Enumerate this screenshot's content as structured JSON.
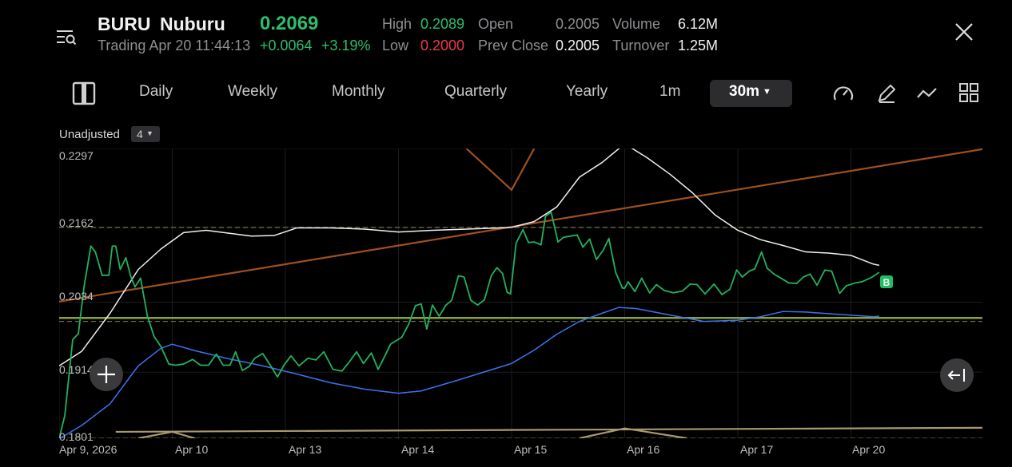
{
  "header": {
    "ticker": "BURU",
    "name": "Nuburu",
    "price": "0.2069",
    "status": "Trading Apr 20 11:44:13",
    "change": "+0.0064",
    "change_pct": "+3.19%",
    "high_label": "High",
    "high_value": "0.2089",
    "low_label": "Low",
    "low_value": "0.2000",
    "open_label": "Open",
    "open_value": "0.2005",
    "prev_close_label": "Prev Close",
    "prev_close_value": "0.2005",
    "volume_label": "Volume",
    "volume_value": "6.12M",
    "turnover_label": "Turnover",
    "turnover_value": "1.25M",
    "menu_icon": "menu-search-icon",
    "close_icon": "close-icon"
  },
  "toolbar": {
    "layout_icon": "split-layout-icon",
    "tabs": [
      "Daily",
      "Weekly",
      "Monthly",
      "Quarterly",
      "Yearly",
      "1m",
      "30m"
    ],
    "active_tab": "30m",
    "tools": [
      "speedometer-icon",
      "pen-icon",
      "line-icon",
      "grid-icon"
    ]
  },
  "chart_options": {
    "adjust_label": "Unadjusted",
    "indicator_count": "4"
  },
  "colors": {
    "price_line": "#21b25f",
    "ma_blue": "#3b73f0",
    "ma_white": "#f0f0f0",
    "trend_brown": "#a0501e",
    "support_olive": "#8aa23a",
    "bottom_tan": "#a89a6e",
    "buy_marker": "#1fbf5f"
  },
  "chart_data": {
    "type": "line",
    "ylim": [
      0.1801,
      0.2297
    ],
    "yticks": [
      "0.2297",
      "0.2162",
      "0.2034",
      "0.1914",
      "0.1801"
    ],
    "xticks": [
      "Apr 9, 2026",
      "Apr 10",
      "Apr 13",
      "Apr 14",
      "Apr 15",
      "Apr 16",
      "Apr 17",
      "Apr 20"
    ],
    "x_positions": [
      0,
      1,
      2,
      3,
      4,
      5,
      6,
      7
    ],
    "buy_marker_label": "B",
    "series": [
      {
        "key": "price",
        "color": "#21b25f",
        "x": [
          0,
          0.05,
          0.12,
          0.17,
          0.22,
          0.28,
          0.32,
          0.38,
          0.44,
          0.47,
          0.5,
          0.54,
          0.59,
          0.63,
          0.67,
          0.72,
          0.78,
          0.84,
          0.9,
          0.97,
          1.03,
          1.1,
          1.18,
          1.25,
          1.32,
          1.39,
          1.45,
          1.51,
          1.56,
          1.62,
          1.68,
          1.73,
          1.8,
          1.87,
          1.93,
          1.99,
          2.05,
          2.12,
          2.2,
          2.27,
          2.34,
          2.42,
          2.5,
          2.57,
          2.63,
          2.69,
          2.76,
          2.82,
          2.88,
          2.93,
          2.98,
          3.03,
          3.09,
          3.15,
          3.2,
          3.25,
          3.3,
          3.36,
          3.42,
          3.47,
          3.53,
          3.58,
          3.64,
          3.7,
          3.76,
          3.82,
          3.87,
          3.92,
          3.96,
          3.99,
          4.04,
          4.1,
          4.15,
          4.2,
          4.26,
          4.3,
          4.35,
          4.41,
          4.46,
          4.52,
          4.58,
          4.63,
          4.69,
          4.75,
          4.81,
          4.86,
          4.92,
          4.98,
          5.0,
          5.03,
          5.09,
          5.15,
          5.22,
          5.28,
          5.35,
          5.43,
          5.51,
          5.58,
          5.64,
          5.71,
          5.79,
          5.86,
          5.93,
          5.99,
          6.04,
          6.1,
          6.15,
          6.21,
          6.26,
          6.32,
          6.39,
          6.45,
          6.52,
          6.58,
          6.64,
          6.7,
          6.77,
          6.83,
          6.9,
          6.96,
          7.04,
          7.1,
          7.18,
          7.25
        ],
        "y": [
          0.18,
          0.184,
          0.197,
          0.198,
          0.206,
          0.213,
          0.212,
          0.208,
          0.208,
          0.213,
          0.213,
          0.209,
          0.211,
          0.208,
          0.206,
          0.2075,
          0.201,
          0.1975,
          0.1958,
          0.1928,
          0.1926,
          0.1928,
          0.1936,
          0.1926,
          0.1926,
          0.1945,
          0.1926,
          0.1926,
          0.1949,
          0.1917,
          0.1924,
          0.1938,
          0.1946,
          0.1925,
          0.1906,
          0.1927,
          0.1942,
          0.1925,
          0.1938,
          0.1935,
          0.1949,
          0.1919,
          0.1916,
          0.1933,
          0.1949,
          0.1929,
          0.1947,
          0.1919,
          0.1942,
          0.1962,
          0.1968,
          0.1974,
          0.1996,
          0.2028,
          0.2031,
          0.1988,
          0.2029,
          0.201,
          0.2029,
          0.2037,
          0.2079,
          0.2077,
          0.2037,
          0.2029,
          0.2038,
          0.2079,
          0.2093,
          0.2083,
          0.2051,
          0.2048,
          0.2135,
          0.2158,
          0.2136,
          0.2137,
          0.2132,
          0.2181,
          0.2188,
          0.2137,
          0.2145,
          0.2147,
          0.2149,
          0.2128,
          0.2142,
          0.2107,
          0.2123,
          0.2143,
          0.2085,
          0.2058,
          0.2058,
          0.2069,
          0.2052,
          0.2075,
          0.205,
          0.2064,
          0.2054,
          0.205,
          0.2053,
          0.2065,
          0.2064,
          0.2048,
          0.2065,
          0.2047,
          0.2056,
          0.2089,
          0.2077,
          0.2087,
          0.2091,
          0.212,
          0.2092,
          0.2082,
          0.2074,
          0.2067,
          0.2066,
          0.2077,
          0.2082,
          0.2063,
          0.2089,
          0.2087,
          0.2049,
          0.2062,
          0.2067,
          0.2069,
          0.2076,
          0.2085
        ]
      },
      {
        "key": "ma_blue",
        "color": "#3b73f0",
        "x": [
          0,
          0.2,
          0.45,
          0.7,
          0.9,
          1.0,
          1.2,
          1.5,
          1.8,
          2.1,
          2.4,
          2.7,
          3.0,
          3.2,
          3.5,
          3.8,
          4.0,
          4.2,
          4.4,
          4.6,
          4.8,
          4.95,
          5.1,
          5.4,
          5.7,
          6.0,
          6.2,
          6.4,
          6.6,
          6.9,
          7.2,
          7.25
        ],
        "y": [
          0.18,
          0.1823,
          0.186,
          0.1925,
          0.1955,
          0.1962,
          0.1951,
          0.1937,
          0.1925,
          0.1911,
          0.1896,
          0.1885,
          0.1878,
          0.1882,
          0.1899,
          0.1917,
          0.1929,
          0.1952,
          0.1979,
          0.2001,
          0.2015,
          0.2025,
          0.2023,
          0.2012,
          0.2001,
          0.2003,
          0.2009,
          0.2018,
          0.2017,
          0.2013,
          0.2009,
          0.201
        ]
      },
      {
        "key": "ma_white",
        "color": "#f0f0f0",
        "x": [
          0,
          0.2,
          0.45,
          0.7,
          0.9,
          1.1,
          1.3,
          1.5,
          1.7,
          1.9,
          2.1,
          2.4,
          2.7,
          3.0,
          3.3,
          3.6,
          3.9,
          4.0,
          4.2,
          4.4,
          4.6,
          4.8,
          5.0,
          5.2,
          5.4,
          5.6,
          5.8,
          6.0,
          6.2,
          6.4,
          6.6,
          6.8,
          7.0,
          7.2,
          7.25
        ],
        "y": [
          0.1925,
          0.195,
          0.2015,
          0.209,
          0.2125,
          0.2153,
          0.2157,
          0.2152,
          0.2147,
          0.2148,
          0.2161,
          0.2161,
          0.2159,
          0.2154,
          0.2157,
          0.2159,
          0.2161,
          0.2162,
          0.2172,
          0.2197,
          0.2248,
          0.2273,
          0.2305,
          0.2281,
          0.2253,
          0.2221,
          0.2183,
          0.2157,
          0.2141,
          0.2131,
          0.212,
          0.2118,
          0.2114,
          0.2099,
          0.2097
        ]
      }
    ],
    "overlays": [
      {
        "key": "trend_brown",
        "x": [
          0,
          8.2
        ],
        "y": [
          0.2035,
          0.2297
        ]
      },
      {
        "key": "v_brown",
        "x": [
          3.6,
          4.0,
          4.2
        ],
        "y": [
          0.2297,
          0.2226,
          0.2297
        ]
      },
      {
        "key": "support_olive",
        "x": [
          0,
          8.2
        ],
        "y": [
          0.2007,
          0.2007
        ]
      },
      {
        "key": "bottom_tan",
        "x": [
          0.5,
          8.2
        ],
        "y": [
          0.1812,
          0.1819
        ]
      },
      {
        "key": "tan_peak_a",
        "x": [
          0.7,
          1.0,
          1.2
        ],
        "y": [
          0.1801,
          0.1812,
          0.1801
        ]
      },
      {
        "key": "tan_peak_b",
        "x": [
          4.6,
          5.0,
          5.55
        ],
        "y": [
          0.1801,
          0.1818,
          0.1801
        ]
      }
    ],
    "reference_lines": [
      {
        "key": "dash_top",
        "y": 0.2162,
        "color": "#6a6a52"
      },
      {
        "key": "dash_mid",
        "y": 0.2001,
        "color": "#6a6a52"
      },
      {
        "key": "dash_low",
        "y": 0.1801,
        "color": "#6a7a32"
      }
    ]
  },
  "actions": {
    "zoom_icon": "plus-crosshair-icon",
    "collapse_icon": "collapse-left-icon"
  }
}
